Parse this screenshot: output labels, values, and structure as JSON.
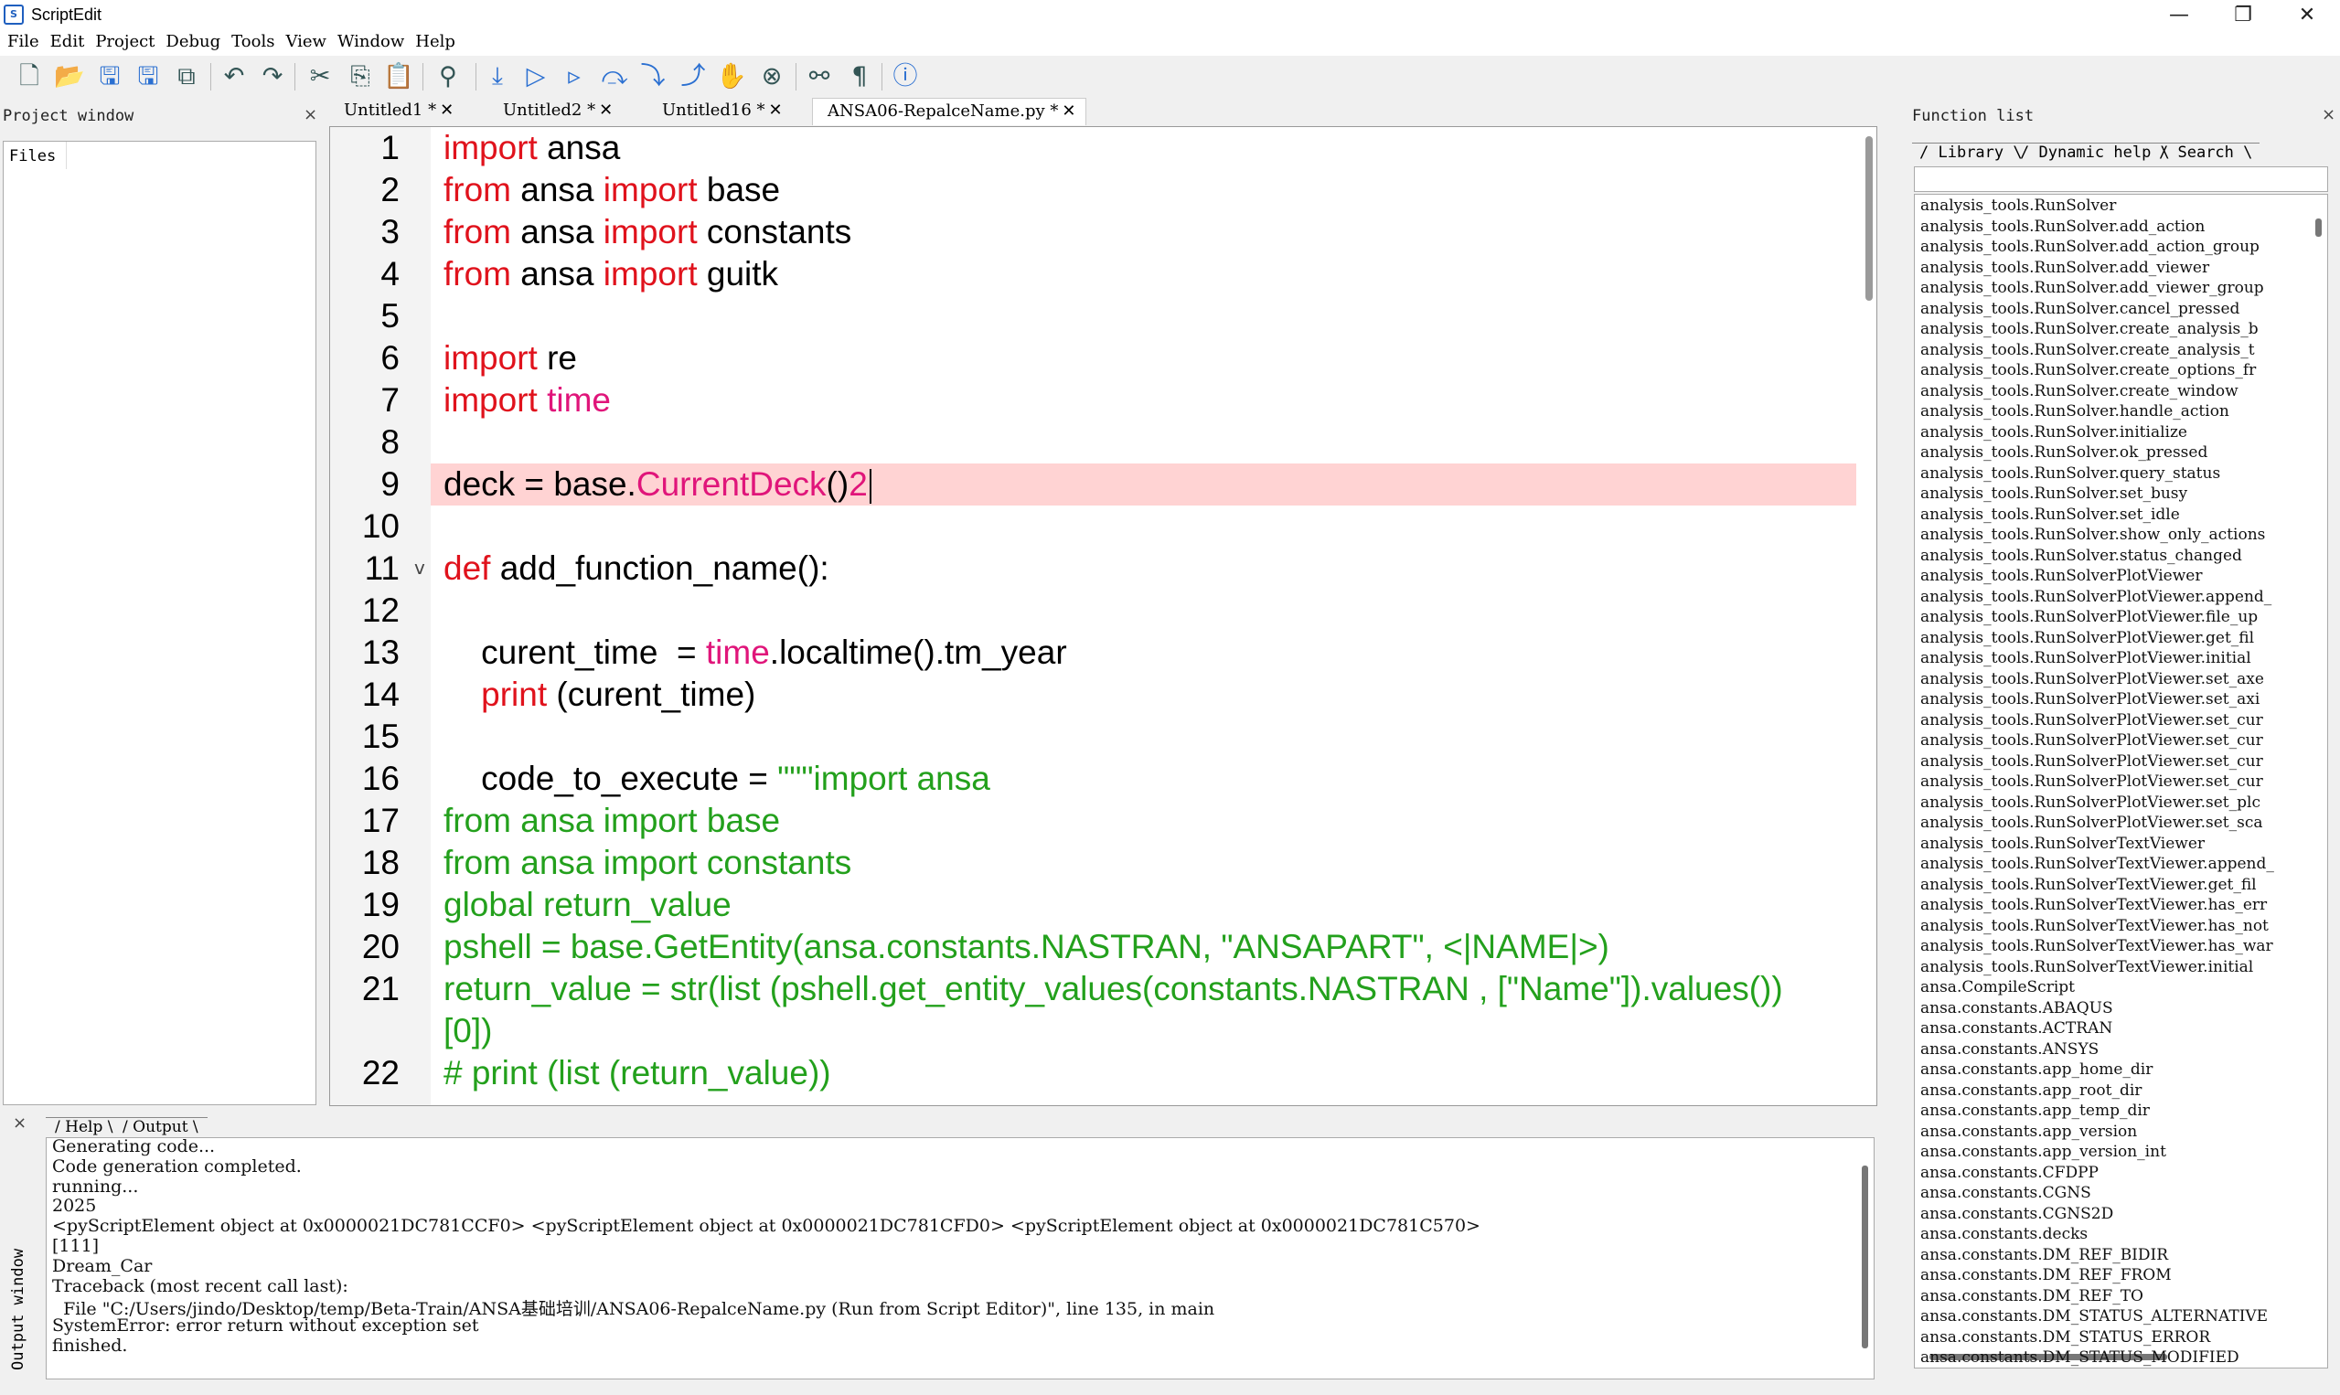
{
  "window": {
    "title": "ScriptEdit",
    "minimize": "—",
    "restore": "❐",
    "close": "✕"
  },
  "menu": [
    "File",
    "Edit",
    "Project",
    "Debug",
    "Tools",
    "View",
    "Window",
    "Help"
  ],
  "toolbar": {
    "icons": [
      "new-file-icon",
      "open-folder-icon",
      "save-icon",
      "save-all-icon",
      "save-as-icon",
      "undo-icon",
      "redo-icon",
      "cut-icon",
      "copy-icon",
      "paste-icon",
      "find-icon",
      "import-icon",
      "run-icon",
      "run-to-icon",
      "step-over-icon",
      "step-into-icon",
      "step-out-icon",
      "breakpoint-hand-icon",
      "clear-breakpoints-icon",
      "watch-glasses-icon",
      "pilcrow-icon",
      "help-icon"
    ]
  },
  "project_window": {
    "title": "Project window",
    "close": "×",
    "files_label": "Files"
  },
  "editor_tabs": [
    {
      "label": "Untitled1 *",
      "active": false
    },
    {
      "label": "Untitled2 *",
      "active": false
    },
    {
      "label": "Untitled16 *",
      "active": false
    },
    {
      "label": "ANSA06-RepalceName.py *",
      "active": true
    }
  ],
  "editor": {
    "lines": [
      {
        "n": "1",
        "tokens": [
          {
            "t": "import",
            "c": "kw"
          },
          {
            "t": " ansa",
            "c": "plain"
          }
        ]
      },
      {
        "n": "2",
        "tokens": [
          {
            "t": "from",
            "c": "kw"
          },
          {
            "t": " ansa ",
            "c": "plain"
          },
          {
            "t": "import",
            "c": "kw"
          },
          {
            "t": " base",
            "c": "plain"
          }
        ]
      },
      {
        "n": "3",
        "tokens": [
          {
            "t": "from",
            "c": "kw"
          },
          {
            "t": " ansa ",
            "c": "plain"
          },
          {
            "t": "import",
            "c": "kw"
          },
          {
            "t": " constants",
            "c": "plain"
          }
        ]
      },
      {
        "n": "4",
        "tokens": [
          {
            "t": "from",
            "c": "kw"
          },
          {
            "t": " ansa ",
            "c": "plain"
          },
          {
            "t": "import",
            "c": "kw"
          },
          {
            "t": " guitk",
            "c": "plain"
          }
        ]
      },
      {
        "n": "5",
        "tokens": []
      },
      {
        "n": "6",
        "tokens": [
          {
            "t": "import",
            "c": "kw"
          },
          {
            "t": " re",
            "c": "plain"
          }
        ]
      },
      {
        "n": "7",
        "tokens": [
          {
            "t": "import",
            "c": "kw"
          },
          {
            "t": " ",
            "c": "plain"
          },
          {
            "t": "time",
            "c": "fn"
          }
        ]
      },
      {
        "n": "8",
        "tokens": []
      },
      {
        "n": "9",
        "highlight": true,
        "caret": true,
        "tokens": [
          {
            "t": "deck = base.",
            "c": "plain"
          },
          {
            "t": "CurrentDeck",
            "c": "fn"
          },
          {
            "t": "()",
            "c": "plain"
          },
          {
            "t": "2",
            "c": "fn"
          }
        ]
      },
      {
        "n": "10",
        "tokens": []
      },
      {
        "n": "11",
        "fold": "v",
        "tokens": [
          {
            "t": "def",
            "c": "kw"
          },
          {
            "t": " add_function_name():",
            "c": "plain"
          }
        ]
      },
      {
        "n": "12",
        "tokens": []
      },
      {
        "n": "13",
        "tokens": [
          {
            "t": "    curent_time  = ",
            "c": "plain"
          },
          {
            "t": "time",
            "c": "fn"
          },
          {
            "t": ".localtime().tm_year",
            "c": "plain"
          }
        ]
      },
      {
        "n": "14",
        "tokens": [
          {
            "t": "    ",
            "c": "plain"
          },
          {
            "t": "print",
            "c": "kw"
          },
          {
            "t": " (curent_time)",
            "c": "plain"
          }
        ]
      },
      {
        "n": "15",
        "tokens": []
      },
      {
        "n": "16",
        "tokens": [
          {
            "t": "    code_to_execute = ",
            "c": "plain"
          },
          {
            "t": "\"\"\"import ansa",
            "c": "str"
          }
        ]
      },
      {
        "n": "17",
        "tokens": [
          {
            "t": "from ansa import base",
            "c": "str"
          }
        ]
      },
      {
        "n": "18",
        "tokens": [
          {
            "t": "from ansa import constants",
            "c": "str"
          }
        ]
      },
      {
        "n": "19",
        "tokens": [
          {
            "t": "global return_value",
            "c": "str"
          }
        ]
      },
      {
        "n": "20",
        "tokens": [
          {
            "t": "pshell = base.GetEntity(ansa.constants.NASTRAN, \"ANSAPART\", <|NAME|>)",
            "c": "str"
          }
        ]
      },
      {
        "n": "21",
        "tokens": [
          {
            "t": "return_value = str(list (pshell.get_entity_values(constants.NASTRAN , [\"Name\"]).values())",
            "c": "str"
          }
        ]
      },
      {
        "n": "",
        "tokens": [
          {
            "t": "[0])",
            "c": "str"
          }
        ]
      },
      {
        "n": "22",
        "tokens": [
          {
            "t": "# print (list (return_value))",
            "c": "str"
          }
        ]
      }
    ]
  },
  "function_list": {
    "title": "Function list",
    "close": "×",
    "tabs": [
      "Library",
      "Dynamic help",
      "Search"
    ],
    "items": [
      "analysis_tools.RunSolver",
      "analysis_tools.RunSolver.add_action",
      "analysis_tools.RunSolver.add_action_group",
      "analysis_tools.RunSolver.add_viewer",
      "analysis_tools.RunSolver.add_viewer_group",
      "analysis_tools.RunSolver.cancel_pressed",
      "analysis_tools.RunSolver.create_analysis_b",
      "analysis_tools.RunSolver.create_analysis_t",
      "analysis_tools.RunSolver.create_options_fr",
      "analysis_tools.RunSolver.create_window",
      "analysis_tools.RunSolver.handle_action",
      "analysis_tools.RunSolver.initialize",
      "analysis_tools.RunSolver.ok_pressed",
      "analysis_tools.RunSolver.query_status",
      "analysis_tools.RunSolver.set_busy",
      "analysis_tools.RunSolver.set_idle",
      "analysis_tools.RunSolver.show_only_actions",
      "analysis_tools.RunSolver.status_changed",
      "analysis_tools.RunSolverPlotViewer",
      "analysis_tools.RunSolverPlotViewer.append_",
      "analysis_tools.RunSolverPlotViewer.file_up",
      "analysis_tools.RunSolverPlotViewer.get_fil",
      "analysis_tools.RunSolverPlotViewer.initial",
      "analysis_tools.RunSolverPlotViewer.set_axe",
      "analysis_tools.RunSolverPlotViewer.set_axi",
      "analysis_tools.RunSolverPlotViewer.set_cur",
      "analysis_tools.RunSolverPlotViewer.set_cur",
      "analysis_tools.RunSolverPlotViewer.set_cur",
      "analysis_tools.RunSolverPlotViewer.set_cur",
      "analysis_tools.RunSolverPlotViewer.set_plc",
      "analysis_tools.RunSolverPlotViewer.set_sca",
      "analysis_tools.RunSolverTextViewer",
      "analysis_tools.RunSolverTextViewer.append_",
      "analysis_tools.RunSolverTextViewer.get_fil",
      "analysis_tools.RunSolverTextViewer.has_err",
      "analysis_tools.RunSolverTextViewer.has_not",
      "analysis_tools.RunSolverTextViewer.has_war",
      "analysis_tools.RunSolverTextViewer.initial",
      "ansa.CompileScript",
      "ansa.constants.ABAQUS",
      "ansa.constants.ACTRAN",
      "ansa.constants.ANSYS",
      "ansa.constants.app_home_dir",
      "ansa.constants.app_root_dir",
      "ansa.constants.app_temp_dir",
      "ansa.constants.app_version",
      "ansa.constants.app_version_int",
      "ansa.constants.CFDPP",
      "ansa.constants.CGNS",
      "ansa.constants.CGNS2D",
      "ansa.constants.decks",
      "ansa.constants.DM_REF_BIDIR",
      "ansa.constants.DM_REF_FROM",
      "ansa.constants.DM_REF_TO",
      "ansa.constants.DM_STATUS_ALTERNATIVE",
      "ansa.constants.DM_STATUS_ERROR",
      "ansa.constants.DM_STATUS_MODIFIED"
    ]
  },
  "output": {
    "side_label": "Output window",
    "close": "×",
    "tabs": [
      "Help",
      "Output"
    ],
    "lines": [
      "Generating code...",
      "Code generation completed.",
      "running...",
      "2025",
      "<pyScriptElement object at 0x0000021DC781CCF0> <pyScriptElement object at 0x0000021DC781CFD0> <pyScriptElement object at 0x0000021DC781C570>",
      "[111]",
      "Dream_Car",
      "Traceback (most recent call last):",
      "  File \"C:/Users/jindo/Desktop/temp/Beta-Train/ANSA基础培训/ANSA06-RepalceName.py (Run from Script Editor)\", line 135, in main",
      "SystemError: error return without exception set",
      "finished."
    ]
  }
}
